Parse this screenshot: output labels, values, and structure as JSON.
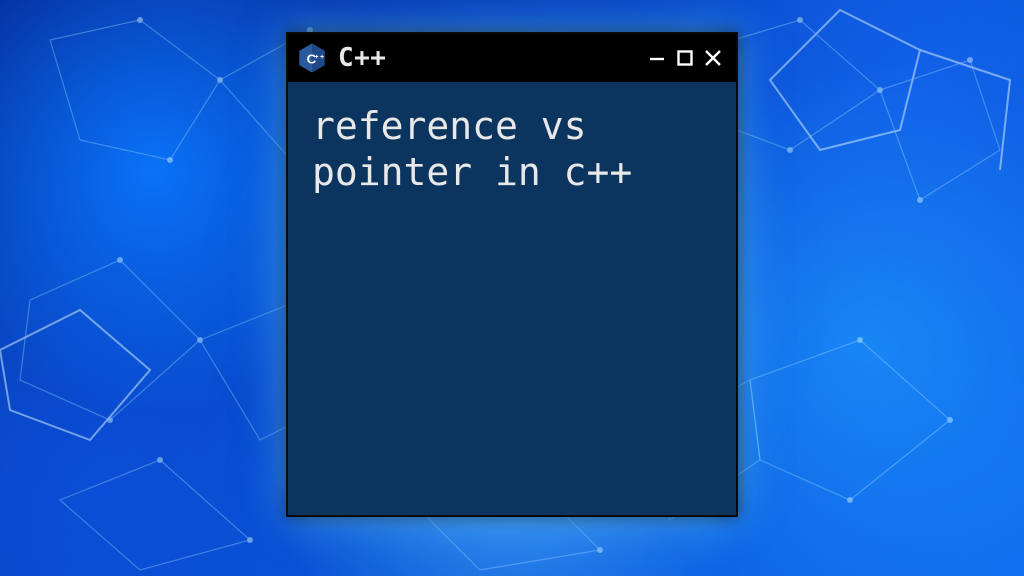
{
  "window": {
    "title": "C++",
    "icon_name": "cpp-hex-icon",
    "content_text": "reference vs pointer in c++"
  },
  "colors": {
    "content_bg": "#0b355f",
    "titlebar_bg": "#000000",
    "text": "#e8e8e8"
  }
}
